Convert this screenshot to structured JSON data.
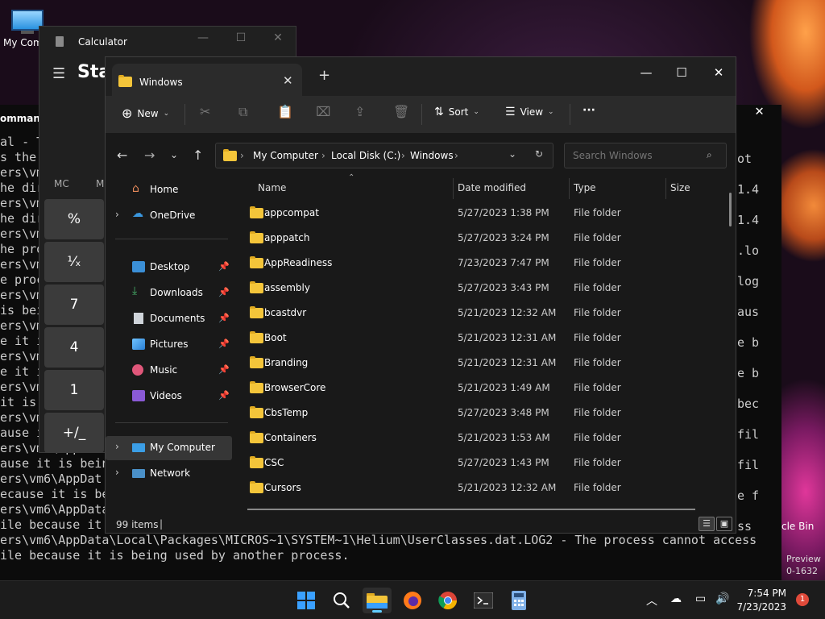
{
  "desktop": {
    "icon_my_computer": "My Com",
    "bin_label": "cle Bin",
    "preview_line1": "Preview",
    "preview_line2": "0-1632"
  },
  "terminal": {
    "tab_label": "ommand",
    "lines": [
      "al - T",
      "s the ",
      "ers\\vm",
      "he dir",
      "ers\\vm",
      "he dir",
      "ers\\vm",
      "he pro",
      "ers\\vm",
      "e proc",
      "ers\\vm",
      "is bei",
      "ers\\vm",
      "e it i",
      "ers\\vm",
      "e it i",
      "ers\\vm",
      "it is",
      "ers\\vm",
      "ause i",
      "ers\\vm6\\AppDat",
      "ause it is bein",
      "ers\\vm6\\AppDat",
      "ecause it is be",
      "ers\\vm6\\AppData",
      "ile because it is being used by another process.",
      "ers\\vm6\\AppData\\Local\\Packages\\MICROS~1\\SYSTEM~1\\Helium\\UserClasses.dat.LOG2 - The process cannot access",
      "ile because it is being used by another process."
    ],
    "right_lines": [
      "ot",
      "1.4",
      "1.4",
      ".lo",
      "log",
      "aus",
      "e b",
      "e b",
      "bec",
      "fil",
      "fil",
      "e f",
      "ss"
    ]
  },
  "calculator": {
    "title": "Calculator",
    "mode": "Star",
    "mem": [
      "MC",
      "M"
    ],
    "buttons": [
      "%",
      "¹⁄ₓ",
      "7",
      "4",
      "1",
      "+/_"
    ]
  },
  "explorer": {
    "tab_title": "Windows",
    "toolbar": {
      "new_label": "New",
      "sort_label": "Sort",
      "view_label": "View",
      "more_label": "···"
    },
    "breadcrumb": [
      "My Computer",
      "Local Disk (C:)",
      "Windows"
    ],
    "search_placeholder": "Search Windows",
    "nav": {
      "home": "Home",
      "onedrive": "OneDrive",
      "desktop": "Desktop",
      "downloads": "Downloads",
      "documents": "Documents",
      "pictures": "Pictures",
      "music": "Music",
      "videos": "Videos",
      "my_computer": "My Computer",
      "network": "Network"
    },
    "columns": {
      "name": "Name",
      "date": "Date modified",
      "type": "Type",
      "size": "Size"
    },
    "files": [
      {
        "name": "appcompat",
        "date": "5/27/2023 1:38 PM",
        "type": "File folder"
      },
      {
        "name": "apppatch",
        "date": "5/27/2023 3:24 PM",
        "type": "File folder"
      },
      {
        "name": "AppReadiness",
        "date": "7/23/2023 7:47 PM",
        "type": "File folder"
      },
      {
        "name": "assembly",
        "date": "5/27/2023 3:43 PM",
        "type": "File folder"
      },
      {
        "name": "bcastdvr",
        "date": "5/21/2023 12:32 AM",
        "type": "File folder"
      },
      {
        "name": "Boot",
        "date": "5/21/2023 12:31 AM",
        "type": "File folder"
      },
      {
        "name": "Branding",
        "date": "5/21/2023 12:31 AM",
        "type": "File folder"
      },
      {
        "name": "BrowserCore",
        "date": "5/21/2023 1:49 AM",
        "type": "File folder"
      },
      {
        "name": "CbsTemp",
        "date": "5/27/2023 3:48 PM",
        "type": "File folder"
      },
      {
        "name": "Containers",
        "date": "5/21/2023 1:53 AM",
        "type": "File folder"
      },
      {
        "name": "CSC",
        "date": "5/27/2023 1:43 PM",
        "type": "File folder"
      },
      {
        "name": "Cursors",
        "date": "5/21/2023 12:32 AM",
        "type": "File folder"
      }
    ],
    "status_count": "99 items"
  },
  "taskbar": {
    "apps": [
      "start",
      "search",
      "file-explorer",
      "firefox",
      "chrome",
      "terminal",
      "calculator"
    ],
    "time": "7:54 PM",
    "date": "7/23/2023",
    "notification_count": "1",
    "accent": "#60cdff"
  }
}
